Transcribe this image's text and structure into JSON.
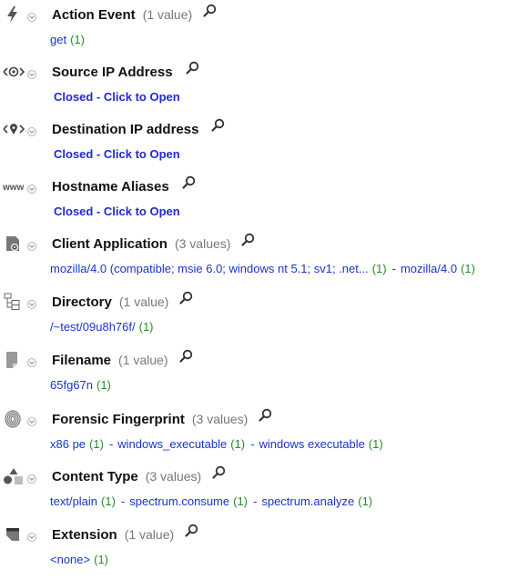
{
  "meta_label": "Closed - Click to Open",
  "rows": [
    {
      "title": "Action Event",
      "count": "(1 value)",
      "icon": "lightning-icon",
      "values": [
        {
          "text": "get",
          "count": "(1)"
        }
      ]
    },
    {
      "title": "Source IP Address",
      "icon": "source-ip-icon",
      "closed": true
    },
    {
      "title": "Destination IP address",
      "icon": "destination-ip-icon",
      "closed": true
    },
    {
      "title": "Hostname Aliases",
      "icon": "www-icon",
      "closed": true
    },
    {
      "title": "Client Application",
      "count": "(3 values)",
      "icon": "application-icon",
      "values": [
        {
          "text": "mozilla/4.0 (compatible; msie 6.0; windows nt 5.1; sv1; .net...",
          "count": "(1)"
        },
        {
          "text": "mozilla/4.0",
          "count": "(1)"
        }
      ]
    },
    {
      "title": "Directory",
      "count": "(1 value)",
      "icon": "directory-tree-icon",
      "values": [
        {
          "text": "/~test/09u8h76f/",
          "count": "(1)"
        }
      ]
    },
    {
      "title": "Filename",
      "count": "(1 value)",
      "icon": "file-icon",
      "values": [
        {
          "text": "65fg67n",
          "count": "(1)"
        }
      ]
    },
    {
      "title": "Forensic Fingerprint",
      "count": "(3 values)",
      "icon": "fingerprint-icon",
      "values": [
        {
          "text": "x86 pe",
          "count": "(1)"
        },
        {
          "text": "windows_executable",
          "count": "(1)"
        },
        {
          "text": "windows executable",
          "count": "(1)"
        }
      ]
    },
    {
      "title": "Content Type",
      "count": "(3 values)",
      "icon": "shapes-icon",
      "values": [
        {
          "text": "text/plain",
          "count": "(1)"
        },
        {
          "text": "spectrum.consume",
          "count": "(1)"
        },
        {
          "text": "spectrum.analyze",
          "count": "(1)"
        }
      ]
    },
    {
      "title": "Extension",
      "count": "(1 value)",
      "icon": "extension-icon",
      "values": [
        {
          "text": "<none>",
          "count": "(1)"
        }
      ]
    }
  ]
}
